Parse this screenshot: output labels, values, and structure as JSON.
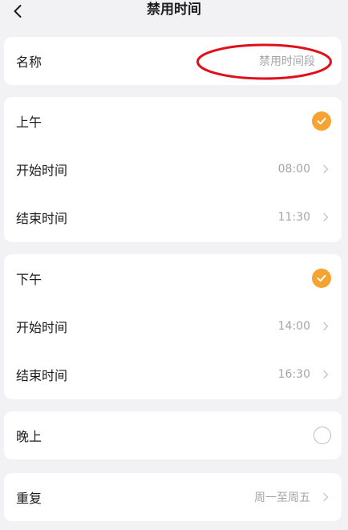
{
  "header": {
    "title": "禁用时间",
    "back_icon": "chevron-left-icon"
  },
  "name_row": {
    "label": "名称",
    "value": "禁用时间段"
  },
  "morning": {
    "label": "上午",
    "checked": true,
    "start_label": "开始时间",
    "start_value": "08:00",
    "end_label": "结束时间",
    "end_value": "11:30"
  },
  "afternoon": {
    "label": "下午",
    "checked": true,
    "start_label": "开始时间",
    "start_value": "14:00",
    "end_label": "结束时间",
    "end_value": "16:30"
  },
  "evening": {
    "label": "晚上",
    "checked": false
  },
  "repeat": {
    "label": "重复",
    "value": "周一至周五"
  },
  "colors": {
    "accent": "#f5a431",
    "annotation": "#e0101a"
  }
}
